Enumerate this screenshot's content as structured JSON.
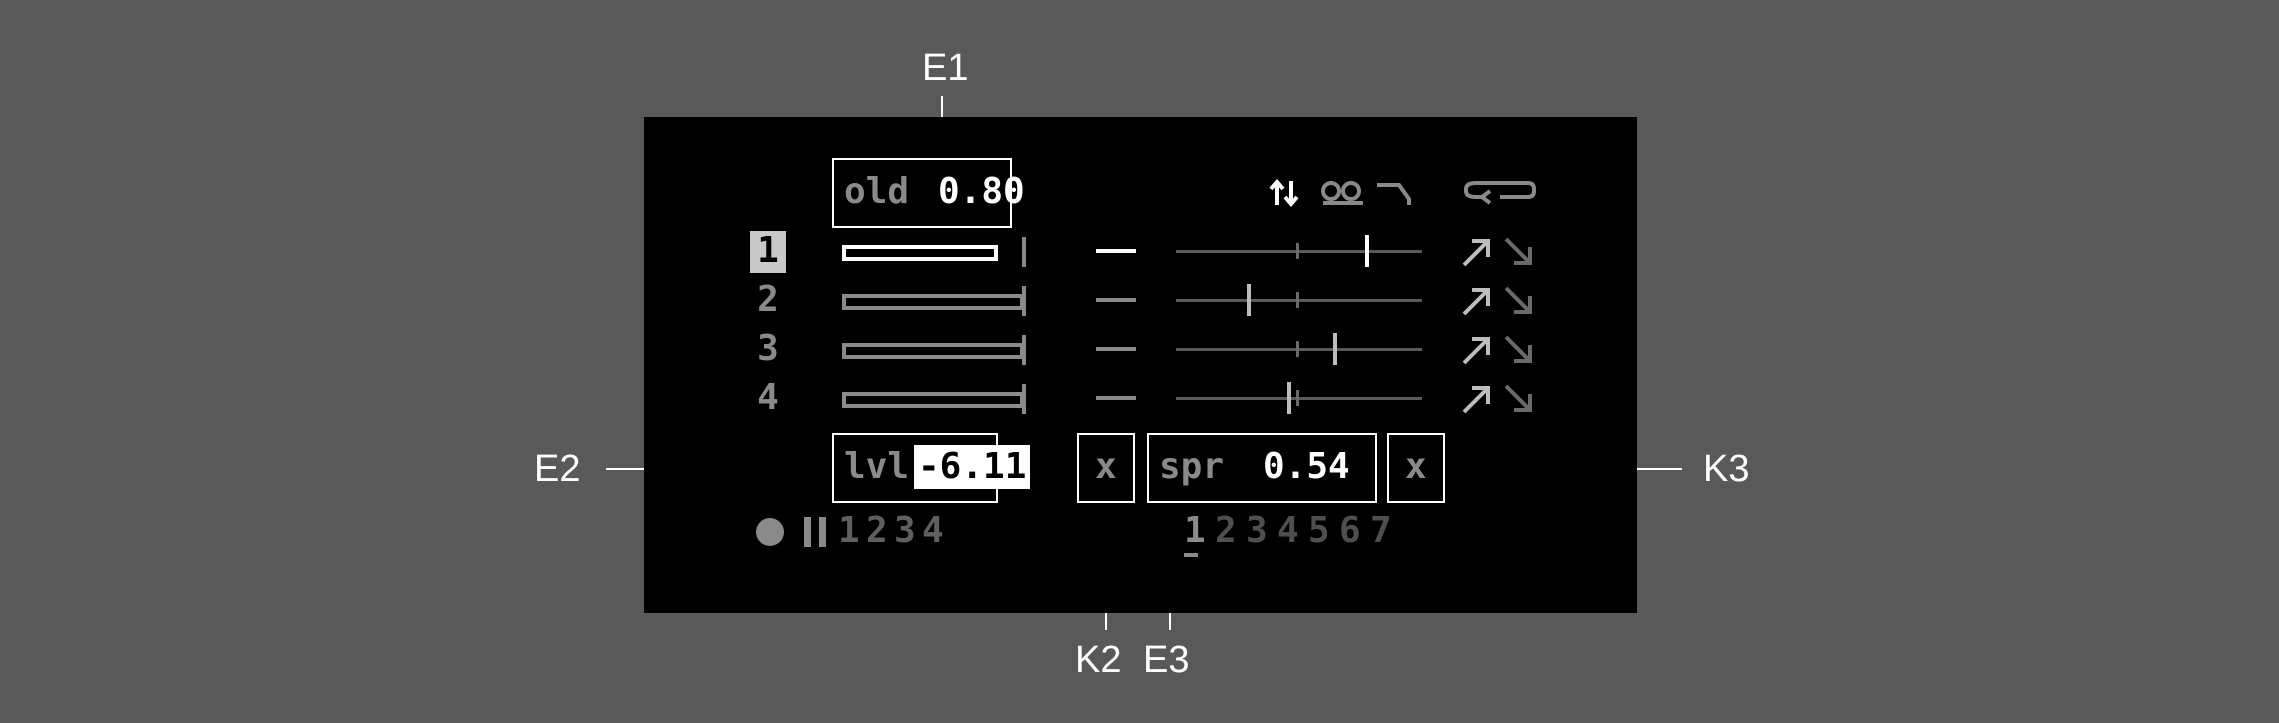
{
  "callouts": {
    "e1": "E1",
    "e2": "E2",
    "e3": "E3",
    "k2": "K2",
    "k3": "K3"
  },
  "params": {
    "old_label": "old",
    "old_value": "0.80",
    "lvl_label": "lvl",
    "lvl_value": "-6.11",
    "spr_label": "spr",
    "spr_value": "0.54",
    "k2_button": "x",
    "k3_button": "x"
  },
  "voices": [
    {
      "label": "1",
      "selected": true,
      "pan": 0.77
    },
    {
      "label": "2",
      "selected": false,
      "pan": 0.29
    },
    {
      "label": "3",
      "selected": false,
      "pan": 0.64
    },
    {
      "label": "4",
      "selected": false,
      "pan": 0.45
    }
  ],
  "header_icons": [
    "updown-arrows-icon",
    "tape-loop-icon",
    "corner-icon",
    "return-loop-icon"
  ],
  "transport": {
    "record": "●",
    "pause": "II",
    "numbers": [
      "1",
      "2",
      "3",
      "4"
    ]
  },
  "patterns": [
    "1",
    "2",
    "3",
    "4",
    "5",
    "6",
    "7"
  ],
  "colors": {
    "background": "#595959",
    "screen": "#000000",
    "active": "#ffffff",
    "inactive": "#8a8a8a"
  }
}
